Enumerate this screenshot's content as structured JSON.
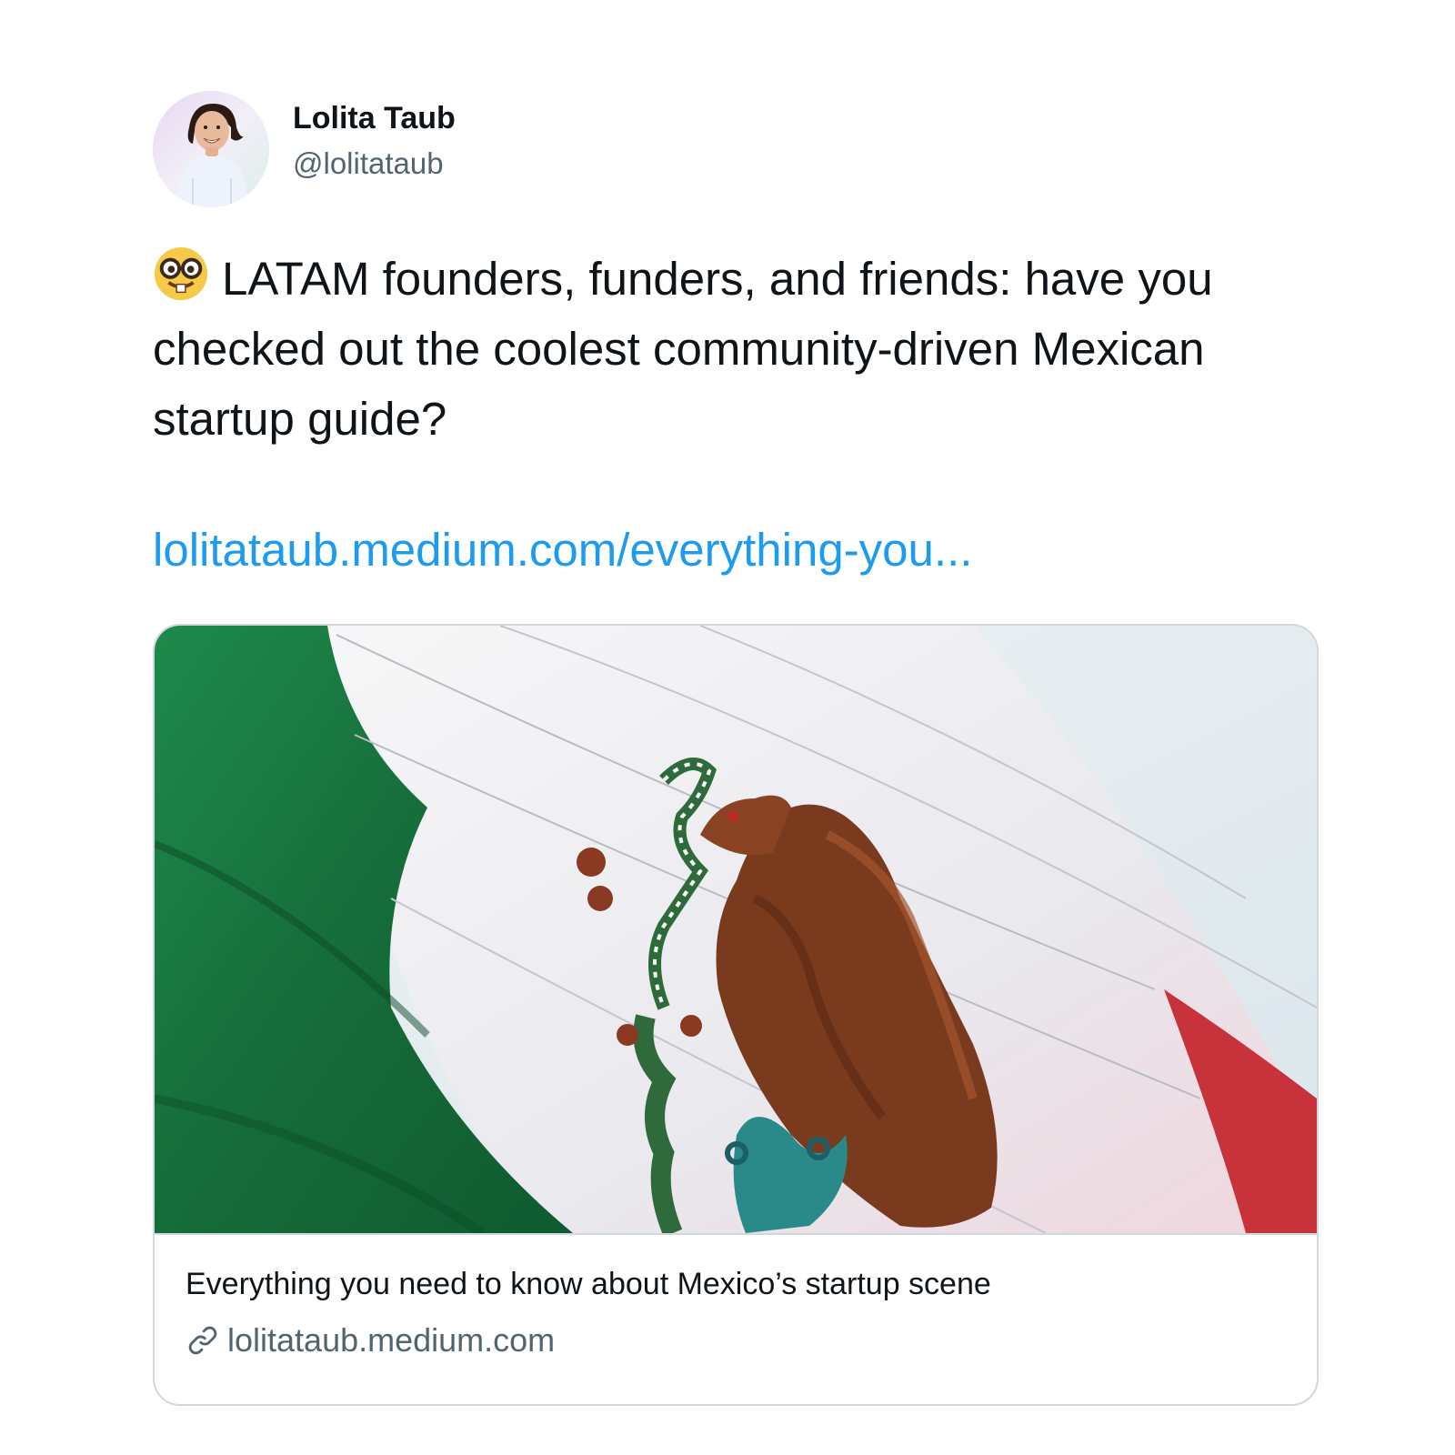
{
  "author": {
    "display_name": "Lolita Taub",
    "handle": "@lolitataub",
    "avatar_icon": "profile-photo"
  },
  "tweet": {
    "emoji_icon": "nerd-face-emoji",
    "text": "LATAM founders, funders, and friends: have you checked out the coolest community-driven Mexican startup guide?",
    "link_text": "lolitataub.medium.com/everything-you..."
  },
  "card": {
    "image_icon": "mexican-flag-photo",
    "title": "Everything you need to know about Mexico’s startup scene",
    "domain": "lolitataub.medium.com",
    "domain_icon": "link-icon"
  },
  "colors": {
    "link": "#1d9bf0",
    "secondary_text": "#536471",
    "border": "#cfd9de",
    "flag_green": "#1f7a45",
    "flag_red": "#c8323a",
    "eagle_brown": "#7a3a1e"
  }
}
